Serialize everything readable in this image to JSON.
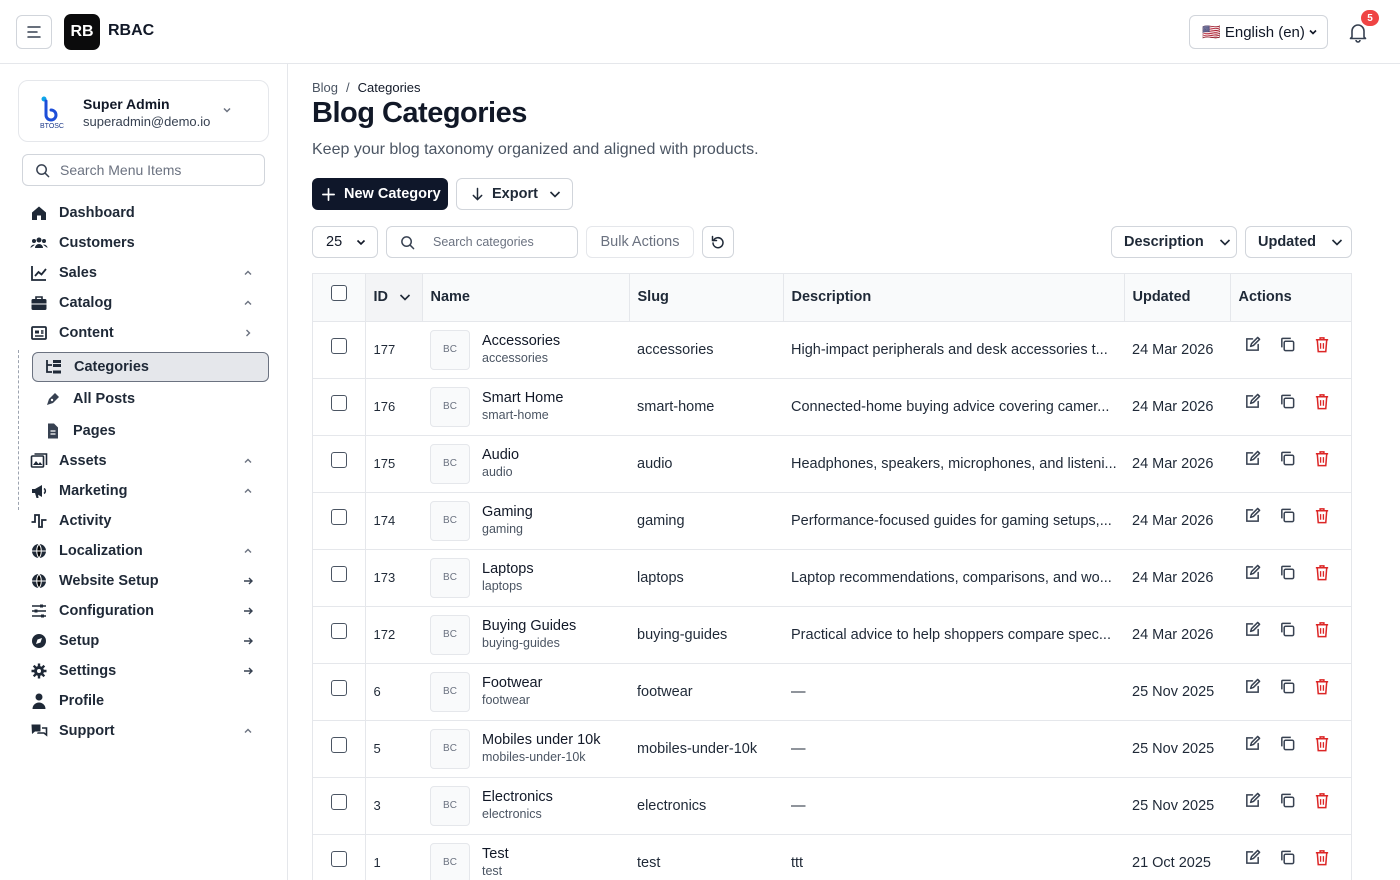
{
  "app": {
    "logo_text": "RB",
    "name": "RBAC",
    "language": "🇺🇸 English (en)",
    "notification_count": "5"
  },
  "user": {
    "name": "Super Admin",
    "email": "superadmin@demo.io",
    "logo_text": "BTOSC"
  },
  "sidebar": {
    "search_placeholder": "Search Menu Items",
    "items": [
      {
        "label": "Dashboard",
        "icon": "home-icon",
        "trail": ""
      },
      {
        "label": "Customers",
        "icon": "users-icon",
        "trail": ""
      },
      {
        "label": "Sales",
        "icon": "chart-icon",
        "trail": "chevron-up-icon"
      },
      {
        "label": "Catalog",
        "icon": "briefcase-icon",
        "trail": "chevron-up-icon"
      },
      {
        "label": "Content",
        "icon": "newspaper-icon",
        "trail": "chevron-right-icon"
      },
      {
        "label": "Assets",
        "icon": "images-icon",
        "trail": "chevron-up-icon"
      },
      {
        "label": "Marketing",
        "icon": "megaphone-icon",
        "trail": "chevron-up-icon"
      },
      {
        "label": "Activity",
        "icon": "activity-icon",
        "trail": ""
      },
      {
        "label": "Localization",
        "icon": "globe-icon",
        "trail": "chevron-up-icon"
      },
      {
        "label": "Website Setup",
        "icon": "globe-icon",
        "trail": "arrow-right-icon"
      },
      {
        "label": "Configuration",
        "icon": "sliders-icon",
        "trail": "arrow-right-icon"
      },
      {
        "label": "Setup",
        "icon": "compass-icon",
        "trail": "arrow-right-icon"
      },
      {
        "label": "Settings",
        "icon": "gear-icon",
        "trail": "arrow-right-icon"
      },
      {
        "label": "Profile",
        "icon": "user-icon",
        "trail": ""
      },
      {
        "label": "Support",
        "icon": "chat-icon",
        "trail": "chevron-up-icon"
      }
    ],
    "subitems": [
      {
        "label": "Categories",
        "icon": "tree-icon",
        "active": true
      },
      {
        "label": "All Posts",
        "icon": "pen-icon",
        "active": false
      },
      {
        "label": "Pages",
        "icon": "file-icon",
        "active": false
      }
    ]
  },
  "page": {
    "breadcrumb": [
      "Blog",
      "/",
      "Categories"
    ],
    "title": "Blog Categories",
    "subtitle": "Keep your blog taxonomy organized and aligned with products.",
    "new_button": "New Category",
    "export_button": "Export"
  },
  "toolbar": {
    "page_size": "25",
    "search_placeholder": "Search categories",
    "bulk_actions": "Bulk Actions",
    "column_toggle_1": "Description",
    "column_toggle_2": "Updated"
  },
  "table": {
    "columns": [
      "ID",
      "Name",
      "Slug",
      "Description",
      "Updated",
      "Actions"
    ],
    "thumb_text": "BC",
    "rows": [
      {
        "id": "177",
        "name": "Accessories",
        "sub": "accessories",
        "slug": "accessories",
        "desc": "High-impact peripherals and desk accessories t...",
        "updated": "24 Mar 2026"
      },
      {
        "id": "176",
        "name": "Smart Home",
        "sub": "smart-home",
        "slug": "smart-home",
        "desc": "Connected-home buying advice covering camer...",
        "updated": "24 Mar 2026"
      },
      {
        "id": "175",
        "name": "Audio",
        "sub": "audio",
        "slug": "audio",
        "desc": "Headphones, speakers, microphones, and listeni...",
        "updated": "24 Mar 2026"
      },
      {
        "id": "174",
        "name": "Gaming",
        "sub": "gaming",
        "slug": "gaming",
        "desc": "Performance-focused guides for gaming setups,...",
        "updated": "24 Mar 2026"
      },
      {
        "id": "173",
        "name": "Laptops",
        "sub": "laptops",
        "slug": "laptops",
        "desc": "Laptop recommendations, comparisons, and wo...",
        "updated": "24 Mar 2026"
      },
      {
        "id": "172",
        "name": "Buying Guides",
        "sub": "buying-guides",
        "slug": "buying-guides",
        "desc": "Practical advice to help shoppers compare spec...",
        "updated": "24 Mar 2026"
      },
      {
        "id": "6",
        "name": "Footwear",
        "sub": "footwear",
        "slug": "footwear",
        "desc": "—",
        "updated": "25 Nov 2025"
      },
      {
        "id": "5",
        "name": "Mobiles under 10k",
        "sub": "mobiles-under-10k",
        "slug": "mobiles-under-10k",
        "desc": "—",
        "updated": "25 Nov 2025"
      },
      {
        "id": "3",
        "name": "Electronics",
        "sub": "electronics",
        "slug": "electronics",
        "desc": "—",
        "updated": "25 Nov 2025"
      },
      {
        "id": "1",
        "name": "Test",
        "sub": "test",
        "slug": "test",
        "desc": "ttt",
        "updated": "21 Oct 2025"
      }
    ]
  },
  "colors": {
    "primary": "#0f172a",
    "danger": "#dc2626",
    "badge": "#ef4444"
  }
}
